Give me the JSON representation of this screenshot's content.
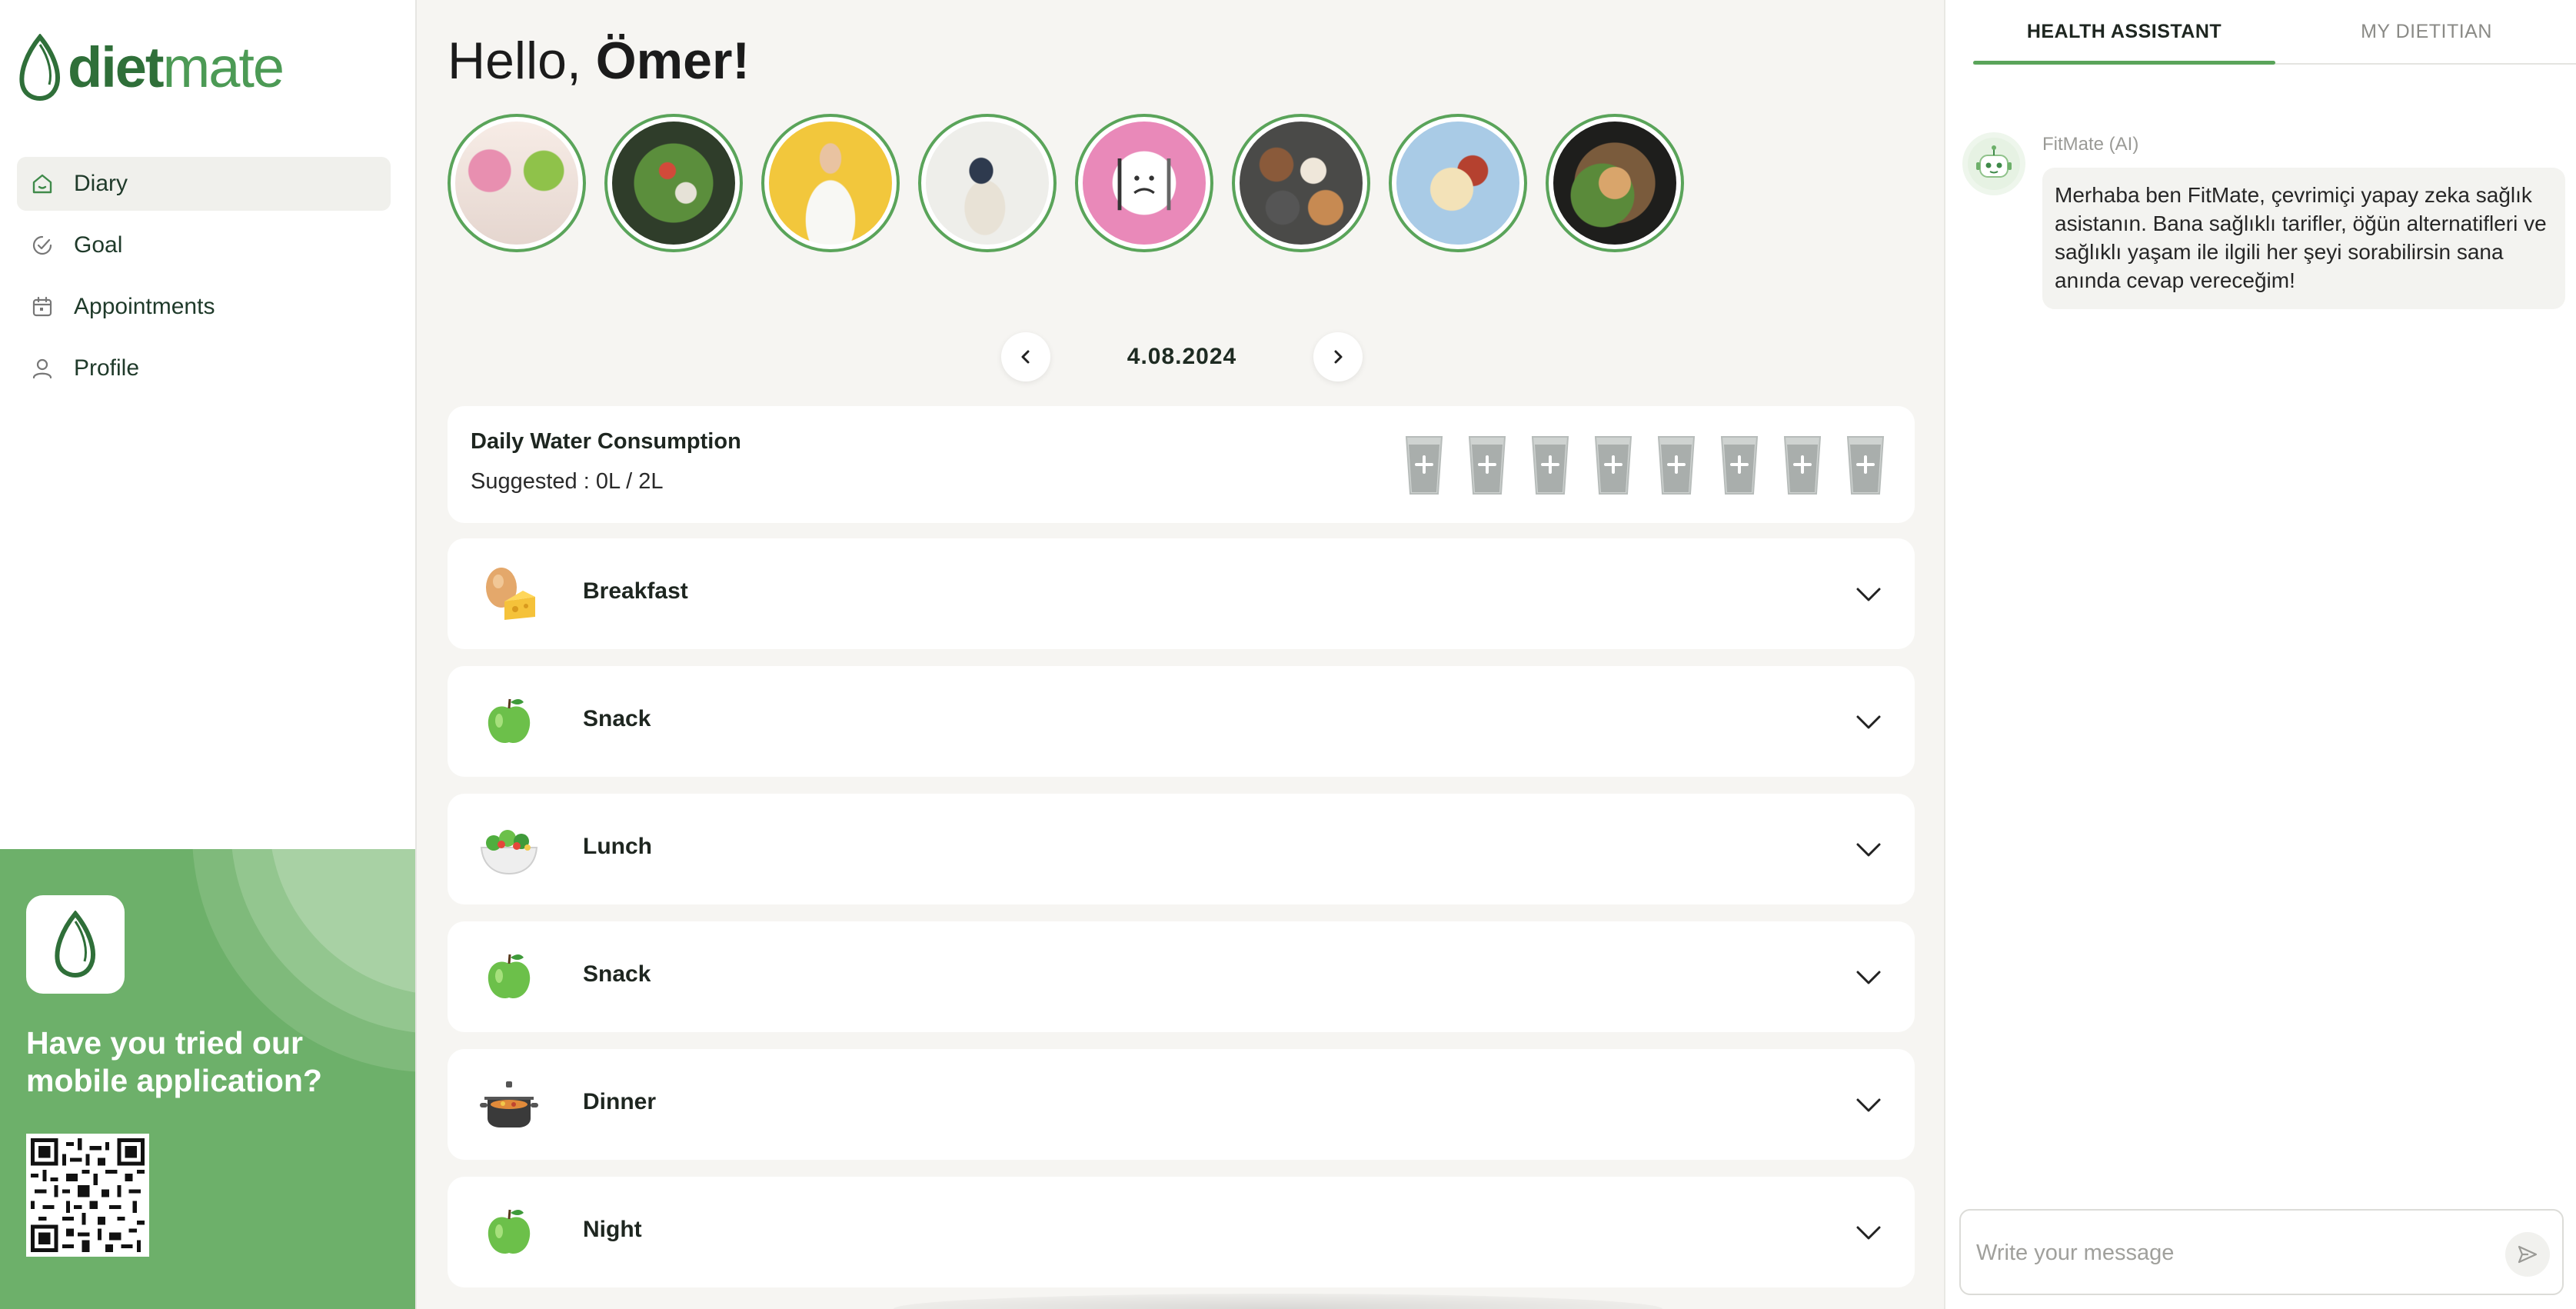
{
  "brand": {
    "name_bold": "diet",
    "name_light": "mate"
  },
  "sidebar": {
    "items": [
      {
        "label": "Diary",
        "icon": "home-icon",
        "active": true
      },
      {
        "label": "Goal",
        "icon": "goal-icon",
        "active": false
      },
      {
        "label": "Appointments",
        "icon": "calendar-icon",
        "active": false
      },
      {
        "label": "Profile",
        "icon": "user-icon",
        "active": false
      }
    ],
    "promo": {
      "title": "Have you tried our mobile application?",
      "qr_icon": "qr-code-icon",
      "app_icon": "app-logo-icon"
    }
  },
  "main": {
    "greeting": "Hello,",
    "user_name": "Ömer!",
    "stories": [
      {
        "icon": "story-donut-apple"
      },
      {
        "icon": "story-salad"
      },
      {
        "icon": "story-person-eating"
      },
      {
        "icon": "story-waist-measure"
      },
      {
        "icon": "story-empty-plate"
      },
      {
        "icon": "story-protein-foods"
      },
      {
        "icon": "story-plated-meal"
      },
      {
        "icon": "story-bowl"
      }
    ],
    "date": "4.08.2024",
    "water": {
      "title": "Daily Water Consumption",
      "suggested": "Suggested : 0L / 2L",
      "glass_count": 8,
      "glass_icon": "water-glass-plus-icon"
    },
    "meals": [
      {
        "label": "Breakfast",
        "icon": "egg-cheese-icon"
      },
      {
        "label": "Snack",
        "icon": "green-apple-icon"
      },
      {
        "label": "Lunch",
        "icon": "salad-bowl-icon"
      },
      {
        "label": "Snack",
        "icon": "green-apple-icon"
      },
      {
        "label": "Dinner",
        "icon": "pot-icon"
      },
      {
        "label": "Night",
        "icon": "green-apple-icon"
      }
    ]
  },
  "assistant": {
    "tabs": [
      "HEALTH ASSISTANT",
      "MY DIETITIAN"
    ],
    "active_tab": 0,
    "bot_name": "FitMate (AI)",
    "message": "Merhaba ben FitMate, çevrimiçi yapay zeka sağlık asistanın. Bana sağlıklı tarifler, öğün alternatifleri ve sağlıklı yaşam ile ilgili her şeyi sorabilirsin sana anında cevap vereceğim!",
    "input_placeholder": "Write your message"
  },
  "colors": {
    "accent": "#5aa45a",
    "promo_bg": "#6db06a",
    "brand": "#3f8a4a"
  }
}
